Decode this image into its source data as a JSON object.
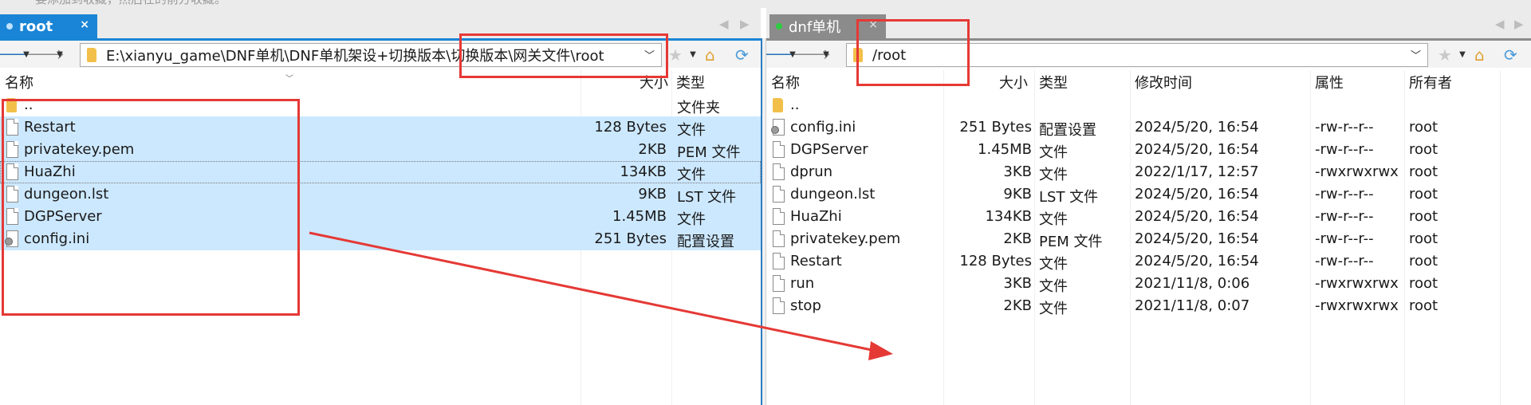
{
  "top_hint": "要添加到收藏，然后在的前方收藏。",
  "left": {
    "tab": {
      "label": "root",
      "close": "×"
    },
    "path": "E:\\xianyu_game\\DNF单机\\DNF单机架设+切换版本\\切换版本\\网关文件\\root",
    "columns": {
      "name": "名称",
      "size": "大小",
      "type": "类型"
    },
    "parent": {
      "name": "..",
      "type": "文件夹"
    },
    "files": [
      {
        "name": "Restart",
        "size": "128 Bytes",
        "type": "文件",
        "icon": "file-icon"
      },
      {
        "name": "privatekey.pem",
        "size": "2KB",
        "type": "PEM 文件",
        "icon": "file-icon"
      },
      {
        "name": "HuaZhi",
        "size": "134KB",
        "type": "文件",
        "icon": "file-icon"
      },
      {
        "name": "dungeon.lst",
        "size": "9KB",
        "type": "LST 文件",
        "icon": "file-icon"
      },
      {
        "name": "DGPServer",
        "size": "1.45MB",
        "type": "文件",
        "icon": "file-icon"
      },
      {
        "name": "config.ini",
        "size": "251 Bytes",
        "type": "配置设置",
        "icon": "config-file-icon"
      }
    ]
  },
  "right": {
    "tab": {
      "label": "dnf单机",
      "close": "×"
    },
    "path": "/root",
    "columns": {
      "name": "名称",
      "size": "大小",
      "type": "类型",
      "modified": "修改时间",
      "attr": "属性",
      "owner": "所有者"
    },
    "parent": {
      "name": ".."
    },
    "files": [
      {
        "name": "config.ini",
        "size": "251 Bytes",
        "type": "配置设置",
        "modified": "2024/5/20, 16:54",
        "attr": "-rw-r--r--",
        "owner": "root",
        "icon": "config-file-icon"
      },
      {
        "name": "DGPServer",
        "size": "1.45MB",
        "type": "文件",
        "modified": "2024/5/20, 16:54",
        "attr": "-rw-r--r--",
        "owner": "root",
        "icon": "file-icon"
      },
      {
        "name": "dprun",
        "size": "3KB",
        "type": "文件",
        "modified": "2022/1/17, 12:57",
        "attr": "-rwxrwxrwx",
        "owner": "root",
        "icon": "file-icon"
      },
      {
        "name": "dungeon.lst",
        "size": "9KB",
        "type": "LST 文件",
        "modified": "2024/5/20, 16:54",
        "attr": "-rw-r--r--",
        "owner": "root",
        "icon": "file-icon"
      },
      {
        "name": "HuaZhi",
        "size": "134KB",
        "type": "文件",
        "modified": "2024/5/20, 16:54",
        "attr": "-rw-r--r--",
        "owner": "root",
        "icon": "file-icon"
      },
      {
        "name": "privatekey.pem",
        "size": "2KB",
        "type": "PEM 文件",
        "modified": "2024/5/20, 16:54",
        "attr": "-rw-r--r--",
        "owner": "root",
        "icon": "file-icon"
      },
      {
        "name": "Restart",
        "size": "128 Bytes",
        "type": "文件",
        "modified": "2024/5/20, 16:54",
        "attr": "-rw-r--r--",
        "owner": "root",
        "icon": "file-icon"
      },
      {
        "name": "run",
        "size": "3KB",
        "type": "文件",
        "modified": "2021/11/8, 0:06",
        "attr": "-rwxrwxrwx",
        "owner": "root",
        "icon": "file-icon"
      },
      {
        "name": "stop",
        "size": "2KB",
        "type": "文件",
        "modified": "2021/11/8, 0:07",
        "attr": "-rwxrwxrwx",
        "owner": "root",
        "icon": "file-icon"
      }
    ]
  },
  "colors": {
    "accent": "#1a85d6",
    "selection": "#cce8ff",
    "annotation": "#e53935",
    "folder": "#f2c04a"
  },
  "icons": [
    "back-arrow-icon",
    "forward-arrow-icon",
    "folder-icon",
    "star-icon",
    "home-folder-icon",
    "refresh-icon",
    "chevron-down-icon",
    "close-icon"
  ]
}
